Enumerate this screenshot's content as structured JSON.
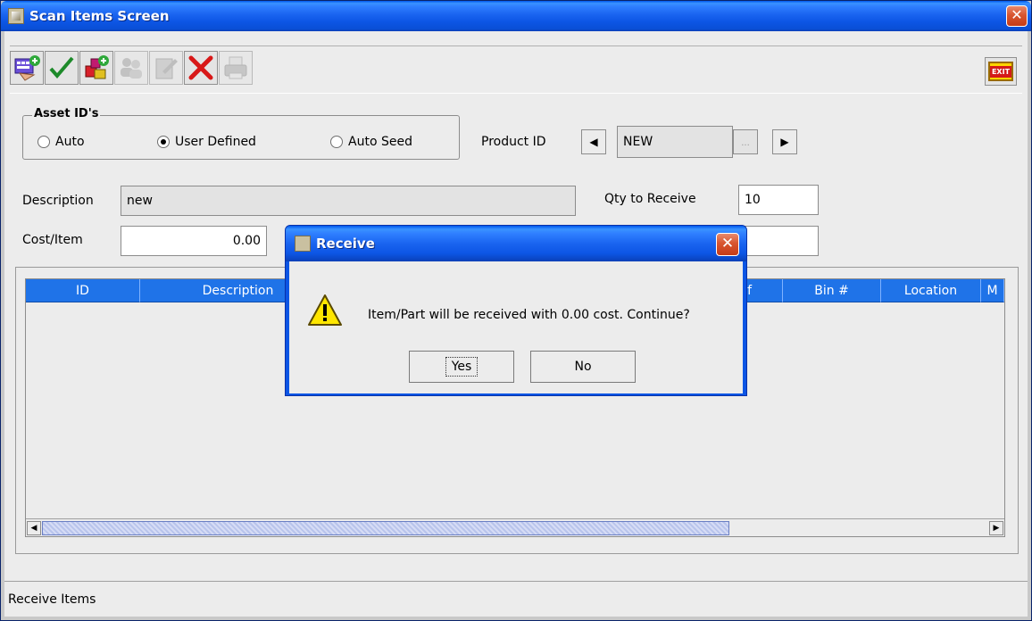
{
  "window": {
    "title": "Scan Items Screen",
    "close_glyph": "✕"
  },
  "toolbar": {
    "icons": [
      "scan-add-icon",
      "checkmark-icon",
      "add-parts-icon",
      "users-icon",
      "edit-icon",
      "delete-x-icon",
      "printer-icon",
      "exit-sign-icon"
    ],
    "exit_label": "EXIT"
  },
  "asset_ids": {
    "legend": "Asset ID's",
    "options": [
      {
        "label": "Auto",
        "selected": false
      },
      {
        "label": "User Defined",
        "selected": true
      },
      {
        "label": "Auto Seed",
        "selected": false
      }
    ]
  },
  "product": {
    "label": "Product ID",
    "value": "NEW",
    "prev_glyph": "◀",
    "next_glyph": "▶",
    "browse_glyph": "..."
  },
  "description": {
    "label": "Description",
    "value": "new"
  },
  "qty": {
    "label": "Qty to Receive",
    "value": "10"
  },
  "cost": {
    "label": "Cost/Item",
    "value": "0.00"
  },
  "other_field": {
    "value": ""
  },
  "table": {
    "columns": [
      "ID",
      "Description",
      "f",
      "Bin #",
      "Location",
      "M"
    ],
    "rows": [],
    "scroll_left_glyph": "◀",
    "scroll_right_glyph": "▶"
  },
  "status": {
    "text": "Receive Items"
  },
  "dialog": {
    "title": "Receive",
    "message": "Item/Part will be received with 0.00 cost. Continue?",
    "yes_label": "Yes",
    "no_label": "No",
    "close_glyph": "✕",
    "icon": "warning-icon"
  },
  "colors": {
    "titlebar": "#0c55e4",
    "table_header": "#1f73e8",
    "close_button": "#d8552f",
    "window_bg": "#ececec"
  }
}
